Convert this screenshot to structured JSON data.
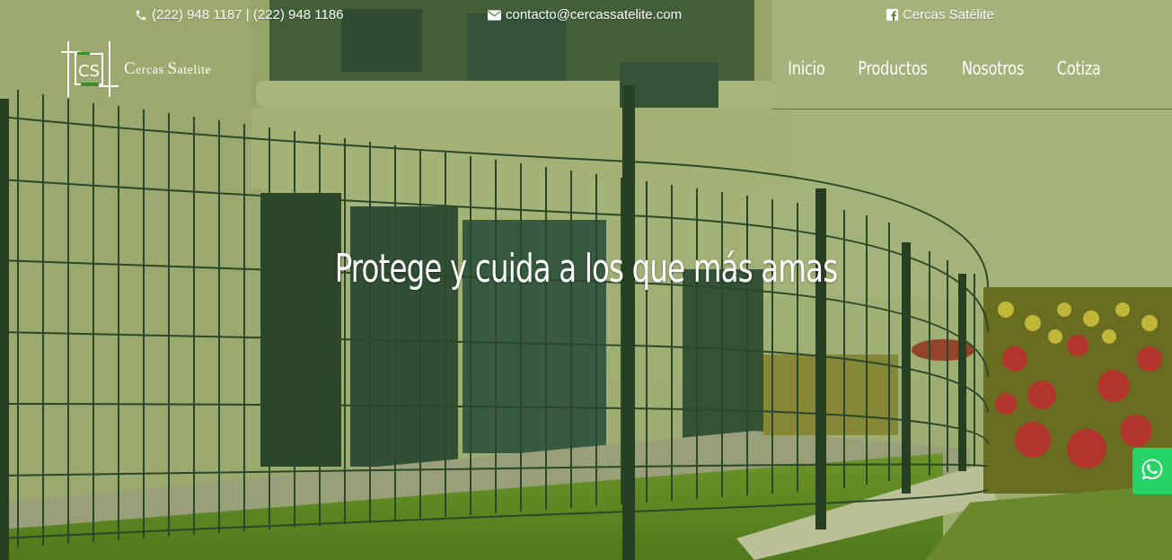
{
  "topbar": {
    "phone": "(222) 948 1187 | (222) 948 1186",
    "email": "contacto@cercassatelite.com",
    "facebook": "Cercas Satélite",
    "icons": [
      "phone-icon",
      "envelope-icon",
      "facebook-icon"
    ]
  },
  "brand": {
    "monogram": "CS",
    "name_cap1": "C",
    "name_rest1": "ercas ",
    "name_cap2": "S",
    "name_rest2": "atelite",
    "accent_color": "#3f8c2b"
  },
  "nav": {
    "items": [
      "Inicio",
      "Productos",
      "Nosotros",
      "Cotiza"
    ]
  },
  "hero": {
    "headline": "Protege y cuida a los que más amas",
    "overlay_color": "#5f7a2a"
  },
  "whatsapp": {
    "icon": "whatsapp-icon",
    "color": "#25d366"
  }
}
